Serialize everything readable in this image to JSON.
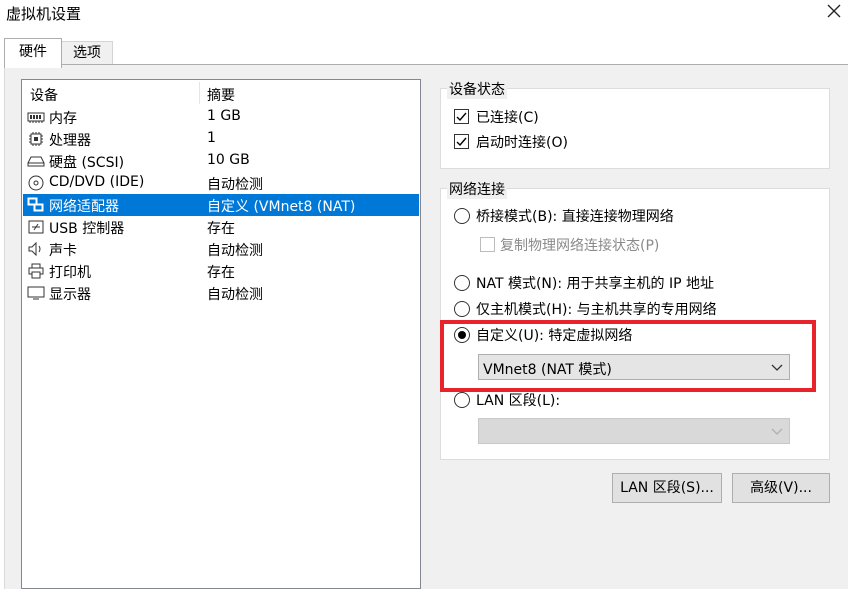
{
  "window": {
    "title": "虚拟机设置"
  },
  "tabs": [
    {
      "label": "硬件",
      "active": true
    },
    {
      "label": "选项",
      "active": false
    }
  ],
  "device_list": {
    "columns": [
      "设备",
      "摘要"
    ],
    "rows": [
      {
        "icon": "memory-icon",
        "name": "内存",
        "summary": "1 GB",
        "selected": false
      },
      {
        "icon": "processor-icon",
        "name": "处理器",
        "summary": "1",
        "selected": false
      },
      {
        "icon": "hard-disk-icon",
        "name": "硬盘 (SCSI)",
        "summary": "10 GB",
        "selected": false
      },
      {
        "icon": "cd-dvd-icon",
        "name": "CD/DVD (IDE)",
        "summary": "自动检测",
        "selected": false
      },
      {
        "icon": "network-adapter-icon",
        "name": "网络适配器",
        "summary": "自定义 (VMnet8 (NAT)",
        "selected": true
      },
      {
        "icon": "usb-icon",
        "name": "USB 控制器",
        "summary": "存在",
        "selected": false
      },
      {
        "icon": "sound-icon",
        "name": "声卡",
        "summary": "自动检测",
        "selected": false
      },
      {
        "icon": "printer-icon",
        "name": "打印机",
        "summary": "存在",
        "selected": false
      },
      {
        "icon": "display-icon",
        "name": "显示器",
        "summary": "自动检测",
        "selected": false
      }
    ]
  },
  "device_status": {
    "title": "设备状态",
    "connected": {
      "label": "已连接(C)",
      "checked": true
    },
    "connect_at_power_on": {
      "label": "启动时连接(O)",
      "checked": true
    }
  },
  "network_connection": {
    "title": "网络连接",
    "bridged": {
      "label": "桥接模式(B): 直接连接物理网络",
      "selected": false
    },
    "replicate": {
      "label": "复制物理网络连接状态(P)",
      "checked": false,
      "enabled": false
    },
    "nat": {
      "label": "NAT 模式(N): 用于共享主机的 IP 地址",
      "selected": false
    },
    "host_only": {
      "label": "仅主机模式(H): 与主机共享的专用网络",
      "selected": false
    },
    "custom": {
      "label": "自定义(U): 特定虚拟网络",
      "selected": true,
      "value": "VMnet8 (NAT 模式)"
    },
    "lan_segment": {
      "label": "LAN 区段(L):",
      "selected": false,
      "value": ""
    }
  },
  "buttons": {
    "lan_segments": "LAN 区段(S)...",
    "advanced": "高级(V)..."
  },
  "colors": {
    "selection": "#0078d7",
    "highlight_box": "#e8232b"
  }
}
